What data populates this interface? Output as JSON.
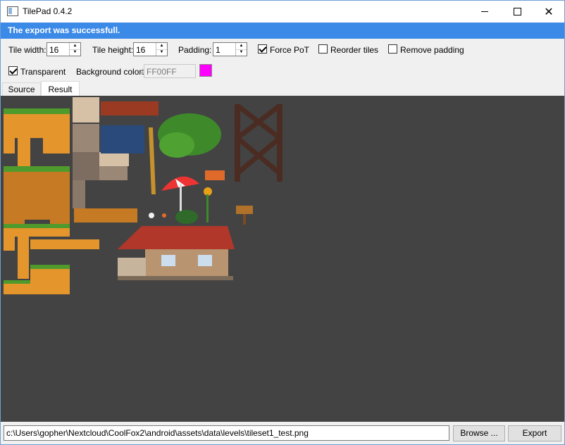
{
  "window": {
    "title": "TilePad 0.4.2"
  },
  "banner": {
    "message": "The export was successfull."
  },
  "options": {
    "tile_width_label": "Tile width:",
    "tile_width": "16",
    "tile_height_label": "Tile height:",
    "tile_height": "16",
    "padding_label": "Padding:",
    "padding": "1",
    "force_pot_label": "Force PoT",
    "force_pot": true,
    "reorder_tiles_label": "Reorder tiles",
    "reorder_tiles": false,
    "remove_padding_label": "Remove padding",
    "remove_padding": false,
    "transparent_label": "Transparent",
    "transparent": true,
    "bg_color_label": "Background color:",
    "bg_color_hash": "#",
    "bg_color_value": "FF00FF",
    "bg_color_swatch": "#ff00ff"
  },
  "tabs": [
    {
      "label": "Source",
      "active": false
    },
    {
      "label": "Result",
      "active": true
    }
  ],
  "canvas": {
    "background": "#434343"
  },
  "footer": {
    "path": "c:\\Users\\gopher\\Nextcloud\\CoolFox2\\android\\assets\\data\\levels\\tileset1_test.png",
    "browse_label": "Browse ...",
    "export_label": "Export"
  },
  "icons": {
    "app": "app-window-icon",
    "minimize": "minimize-icon",
    "maximize": "maximize-icon",
    "close": "close-icon"
  }
}
